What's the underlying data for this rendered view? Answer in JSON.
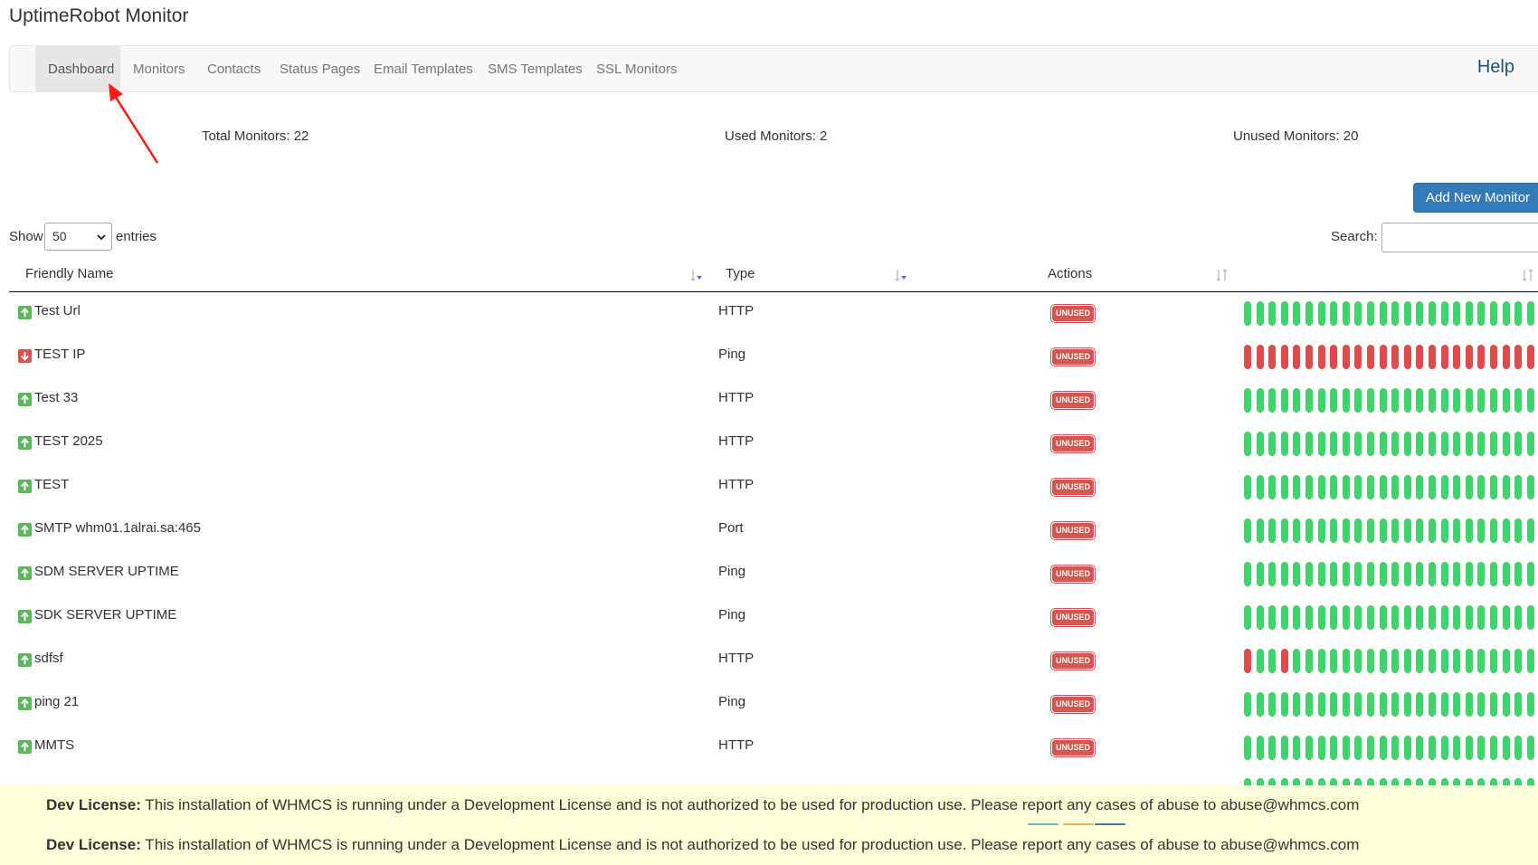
{
  "app": {
    "title": "UptimeRobot Monitor"
  },
  "nav": {
    "tabs": [
      {
        "label": "Dashboard",
        "active": true
      },
      {
        "label": "Monitors"
      },
      {
        "label": "Contacts"
      },
      {
        "label": "Status Pages"
      },
      {
        "label": "Email Templates"
      },
      {
        "label": "SMS Templates"
      },
      {
        "label": "SSL Monitors"
      }
    ],
    "help_label": "Help"
  },
  "stats": {
    "total": "Total Monitors: 22",
    "used": "Used Monitors: 2",
    "unused": "Unused Monitors: 20"
  },
  "toolbar": {
    "add_label": "Add New Monitor"
  },
  "table_controls": {
    "show_label": "Show",
    "entries_value": "50",
    "entries_label": "entries",
    "search_label": "Search:",
    "search_value": ""
  },
  "table": {
    "columns": [
      "Friendly Name",
      "Type",
      "Actions"
    ],
    "rows": [
      {
        "status": "up",
        "name": "Test Url",
        "type": "HTTP",
        "action": "UNUSED",
        "uptime": "gggggggggggggggggggggggg"
      },
      {
        "status": "down",
        "name": "TEST IP",
        "type": "Ping",
        "action": "UNUSED",
        "uptime": "rrrrrrrrrrrrrrrrrrrrrrrr"
      },
      {
        "status": "up",
        "name": "Test 33",
        "type": "HTTP",
        "action": "UNUSED",
        "uptime": "gggggggggggggggggggggggg"
      },
      {
        "status": "up",
        "name": "TEST 2025",
        "type": "HTTP",
        "action": "UNUSED",
        "uptime": "gggggggggggggggggggggggg"
      },
      {
        "status": "up",
        "name": "TEST",
        "type": "HTTP",
        "action": "UNUSED",
        "uptime": "gggggggggggggggggggggggg"
      },
      {
        "status": "up",
        "name": "SMTP whm01.1alrai.sa:465",
        "type": "Port",
        "action": "UNUSED",
        "uptime": "gggggggggggggggggggggggg"
      },
      {
        "status": "up",
        "name": "SDM SERVER UPTIME",
        "type": "Ping",
        "action": "UNUSED",
        "uptime": "gggggggggggggggggggggggg"
      },
      {
        "status": "up",
        "name": "SDK SERVER UPTIME",
        "type": "Ping",
        "action": "UNUSED",
        "uptime": "gggggggggggggggggggggggg"
      },
      {
        "status": "up",
        "name": "sdfsf",
        "type": "HTTP",
        "action": "UNUSED",
        "uptime": "rggrgggggggggggggggggggg"
      },
      {
        "status": "up",
        "name": "ping 21",
        "type": "Ping",
        "action": "UNUSED",
        "uptime": "gggggggggggggggggggggggg"
      },
      {
        "status": "up",
        "name": "MMTS",
        "type": "HTTP",
        "action": "UNUSED",
        "uptime": "gggggggggggggggggggggggg"
      }
    ]
  },
  "banners": [
    {
      "label": "Dev License:",
      "text": " This installation of WHMCS is running under a Development License and is not authorized to be used for production use. Please report any cases of abuse to abuse@whmcs.com"
    },
    {
      "label": "Dev License:",
      "text": " This installation of WHMCS is running under a Development License and is not authorized to be used for production use. Please report any cases of abuse to abuse@whmcs.com"
    }
  ],
  "colors": {
    "up": "#5cb85c",
    "down": "#d9534f",
    "bar_up": "#3fd46a",
    "bar_down": "#e04a4a",
    "primary": "#337ab7",
    "annotation": "#ff1a1a"
  },
  "icons": {
    "up": "arrow-up-icon",
    "down": "arrow-down-icon",
    "sort": "sort-icon",
    "select": "chevron-down-icon"
  }
}
